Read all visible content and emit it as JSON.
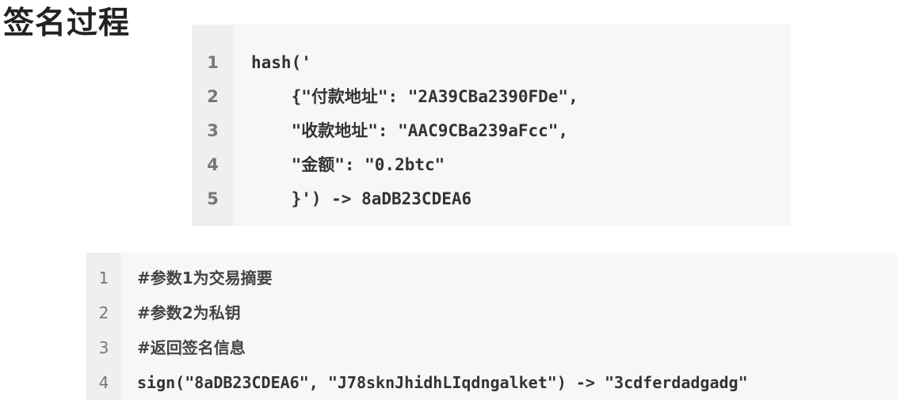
{
  "page": {
    "title": "签名过程"
  },
  "hash_block": {
    "lines": [
      {
        "number": "1",
        "code": "hash('"
      },
      {
        "number": "2",
        "code": "    {\"付款地址\": \"2A39CBa2390FDe\","
      },
      {
        "number": "3",
        "code": "    \"收款地址\": \"AAC9CBa239aFcc\","
      },
      {
        "number": "4",
        "code": "    \"金额\": \"0.2btc\""
      },
      {
        "number": "5",
        "code": "    }') -> 8aDB23CDEA6"
      }
    ]
  },
  "sign_block": {
    "lines": [
      {
        "number": "1",
        "code": "#参数1为交易摘要"
      },
      {
        "number": "2",
        "code": "#参数2为私钥"
      },
      {
        "number": "3",
        "code": "#返回签名信息"
      },
      {
        "number": "4",
        "code": "sign(\"8aDB23CDEA6\", \"J78sknJhidhLIqdngalket\") -> \"3cdferdadgadg\""
      }
    ]
  }
}
